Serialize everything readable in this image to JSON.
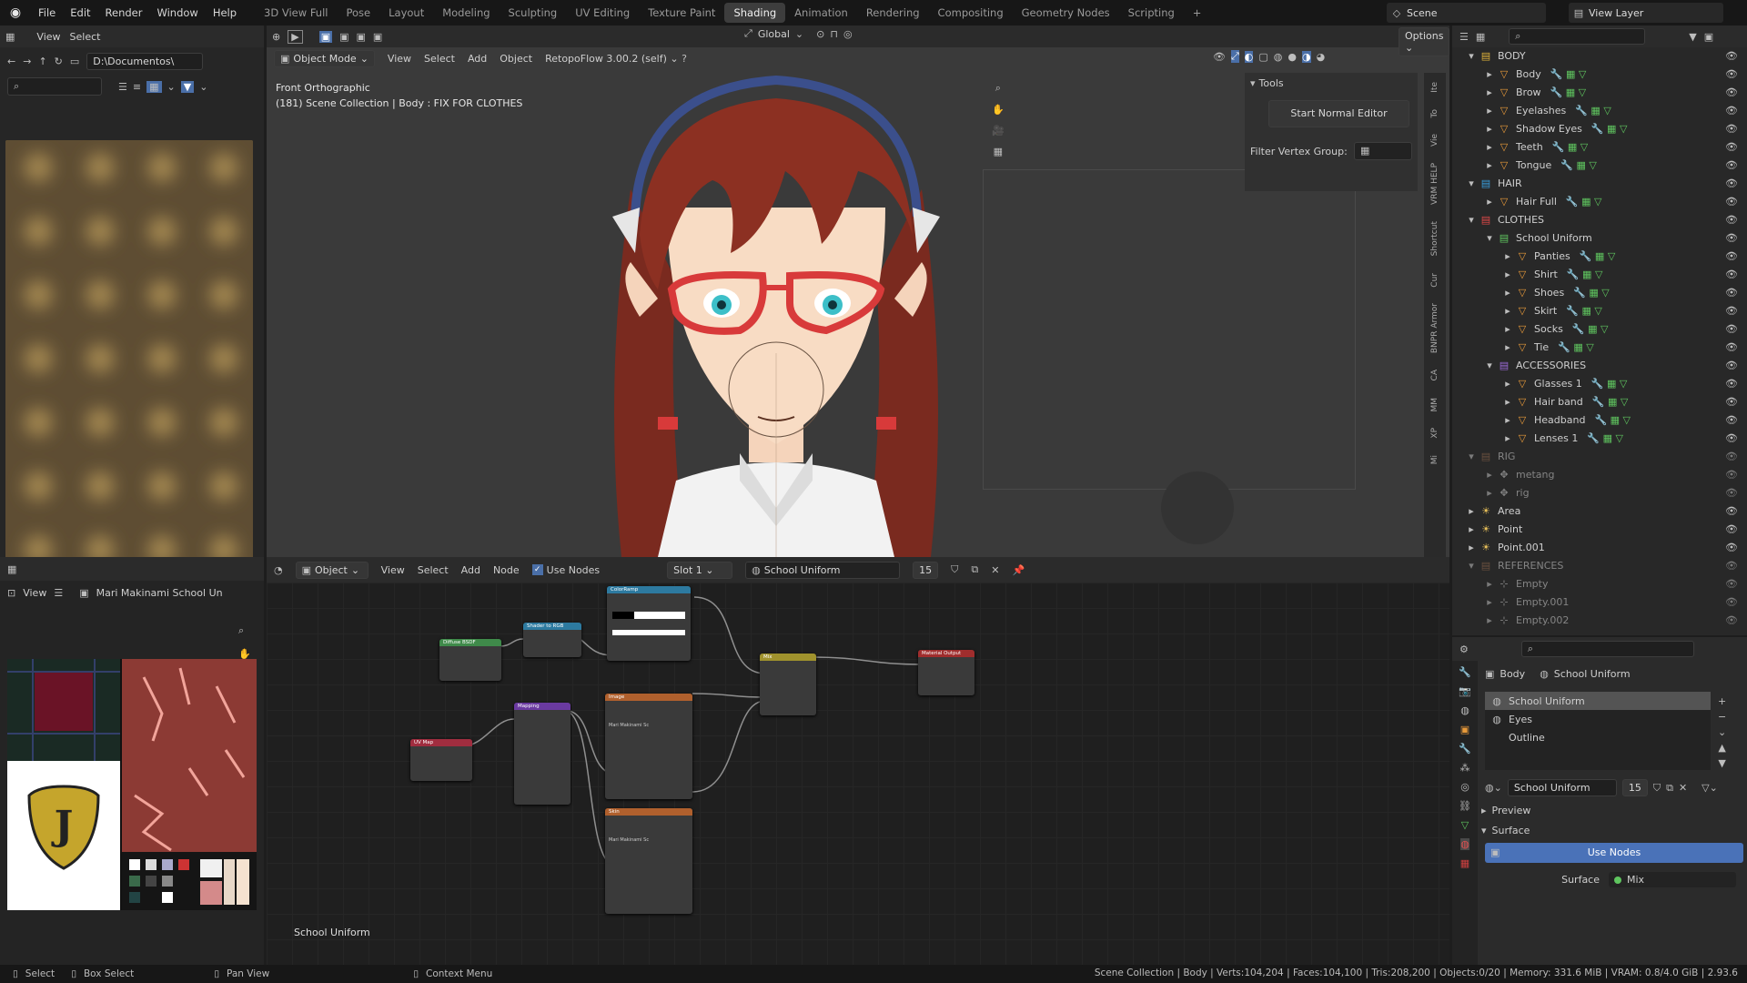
{
  "menu": {
    "items": [
      "File",
      "Edit",
      "Render",
      "Window",
      "Help"
    ],
    "workspaces": [
      "3D View Full",
      "Pose",
      "Layout",
      "Modeling",
      "Sculpting",
      "UV Editing",
      "Texture Paint",
      "Shading",
      "Animation",
      "Rendering",
      "Compositing",
      "Geometry Nodes",
      "Scripting"
    ],
    "active_workspace": "Shading",
    "add_tab": "+",
    "scene_label": "Scene",
    "view_layer_label": "View Layer"
  },
  "file_browser": {
    "menus": [
      "View",
      "Select"
    ],
    "path": "D:\\Documentos\\",
    "search_placeholder": ""
  },
  "viewport": {
    "mode": "Object Mode",
    "menus": [
      "View",
      "Select",
      "Add",
      "Object"
    ],
    "addon": "RetopoFlow 3.00.2 (self)",
    "orientation": "Global",
    "options": "Options",
    "view_name": "Front Orthographic",
    "collection_info": "(181) Scene Collection | Body : FIX FOR CLOTHES",
    "tools_panel": {
      "title": "Tools",
      "start_button": "Start Normal Editor",
      "filter_label": "Filter Vertex Group:"
    },
    "side_tabs": [
      "Ite",
      "To",
      "Vie",
      "VRM HELP",
      "Shortcut",
      "Cur",
      "BNPR Armor",
      "CA",
      "MM",
      "XP",
      "Mi"
    ]
  },
  "node_editor": {
    "type": "Object",
    "menus": [
      "View",
      "Select",
      "Add",
      "Node"
    ],
    "use_nodes_label": "Use Nodes",
    "slot": "Slot 1",
    "material": "School Uniform",
    "user_count": "15",
    "footer_label": "School Uniform",
    "nodes": {
      "diffuse": "Diffuse BSDF",
      "shader_rgb": "Shader to RGB",
      "colorramp": "ColorRamp",
      "mix": "Mix",
      "output": "Material Output",
      "mapping": "Mapping",
      "uvmap": "UV Map",
      "image1": "Image",
      "image2": "Skin",
      "img1_name": "Mari Makinami Sc",
      "img2_name": "Mari Makinami Sc"
    }
  },
  "image_editor": {
    "view_menu": "View",
    "image_name": "Mari Makinami School Unifo"
  },
  "outliner": {
    "search_placeholder": "",
    "rows": [
      {
        "label": "BODY",
        "depth": 0,
        "kind": "collection",
        "color": "#e0b33a"
      },
      {
        "label": "Body",
        "depth": 1,
        "kind": "mesh"
      },
      {
        "label": "Brow",
        "depth": 1,
        "kind": "mesh"
      },
      {
        "label": "Eyelashes",
        "depth": 1,
        "kind": "mesh"
      },
      {
        "label": "Shadow Eyes",
        "depth": 1,
        "kind": "mesh"
      },
      {
        "label": "Teeth",
        "depth": 1,
        "kind": "mesh"
      },
      {
        "label": "Tongue",
        "depth": 1,
        "kind": "mesh"
      },
      {
        "label": "HAIR",
        "depth": 0,
        "kind": "collection",
        "color": "#3aa0e0"
      },
      {
        "label": "Hair Full",
        "depth": 1,
        "kind": "mesh"
      },
      {
        "label": "CLOTHES",
        "depth": 0,
        "kind": "collection",
        "color": "#e04848"
      },
      {
        "label": "School Uniform",
        "depth": 1,
        "kind": "collection",
        "color": "#5fc55f"
      },
      {
        "label": "Panties",
        "depth": 2,
        "kind": "mesh"
      },
      {
        "label": "Shirt",
        "depth": 2,
        "kind": "mesh"
      },
      {
        "label": "Shoes",
        "depth": 2,
        "kind": "mesh"
      },
      {
        "label": "Skirt",
        "depth": 2,
        "kind": "mesh"
      },
      {
        "label": "Socks",
        "depth": 2,
        "kind": "mesh"
      },
      {
        "label": "Tie",
        "depth": 2,
        "kind": "mesh"
      },
      {
        "label": "ACCESSORIES",
        "depth": 1,
        "kind": "collection",
        "color": "#9c6ad8"
      },
      {
        "label": "Glasses 1",
        "depth": 2,
        "kind": "mesh"
      },
      {
        "label": "Hair band",
        "depth": 2,
        "kind": "mesh"
      },
      {
        "label": "Headband",
        "depth": 2,
        "kind": "mesh"
      },
      {
        "label": "Lenses 1",
        "depth": 2,
        "kind": "mesh"
      },
      {
        "label": "RIG",
        "depth": 0,
        "kind": "collection-dim",
        "color": "#a07050"
      },
      {
        "label": "metang",
        "depth": 1,
        "kind": "armature-dim"
      },
      {
        "label": "rig",
        "depth": 1,
        "kind": "armature-dim"
      },
      {
        "label": "Area",
        "depth": 0,
        "kind": "light"
      },
      {
        "label": "Point",
        "depth": 0,
        "kind": "light"
      },
      {
        "label": "Point.001",
        "depth": 0,
        "kind": "light"
      },
      {
        "label": "REFERENCES",
        "depth": 0,
        "kind": "collection-dim",
        "color": "#a07050"
      },
      {
        "label": "Empty",
        "depth": 1,
        "kind": "empty-dim"
      },
      {
        "label": "Empty.001",
        "depth": 1,
        "kind": "empty-dim"
      },
      {
        "label": "Empty.002",
        "depth": 1,
        "kind": "empty-dim"
      }
    ]
  },
  "properties": {
    "object": "Body",
    "material": "School Uniform",
    "slots": [
      "School Uniform",
      "Eyes",
      "Outline"
    ],
    "material_field": "School Uniform",
    "user_count": "15",
    "preview_label": "Preview",
    "surface_label": "Surface",
    "use_nodes_button": "Use Nodes",
    "surface_field_label": "Surface",
    "surface_value": "Mix"
  },
  "status": {
    "select": "Select",
    "box_select": "Box Select",
    "pan_view": "Pan View",
    "context_menu": "Context Menu",
    "stats": "Scene Collection | Body | Verts:104,204 | Faces:104,100 | Tris:208,200 | Objects:0/20 | Memory: 331.6 MiB | VRAM: 0.8/4.0 GiB | 2.93.6"
  }
}
